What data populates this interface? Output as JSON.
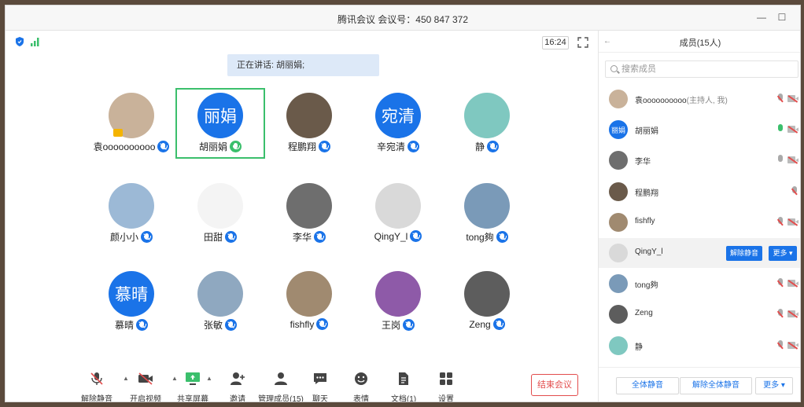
{
  "window": {
    "title": "腾讯会议 会议号：450 847 372"
  },
  "stage": {
    "clock": "16:24",
    "speaking": "正在讲话: 胡丽娟;"
  },
  "participants": [
    {
      "name": "袁oooooooooo",
      "avatar_text": "",
      "avatar_color": "#c9b29a",
      "host": true
    },
    {
      "name": "胡丽娟",
      "avatar_text": "丽娟",
      "avatar_color": "#1a73e8",
      "speaking": true
    },
    {
      "name": "程鹏翔",
      "avatar_text": "",
      "avatar_color": "#6a5a4a"
    },
    {
      "name": "辛宛清",
      "avatar_text": "宛清",
      "avatar_color": "#1a73e8"
    },
    {
      "name": "静",
      "avatar_text": "",
      "avatar_color": "#7fc8c0"
    },
    {
      "name": "颜小小",
      "avatar_text": "",
      "avatar_color": "#9cb9d6"
    },
    {
      "name": "田甜",
      "avatar_text": "",
      "avatar_color": "#f4f4f4"
    },
    {
      "name": "李华",
      "avatar_text": "",
      "avatar_color": "#6e6e6e"
    },
    {
      "name": "QingY_l",
      "avatar_text": "",
      "avatar_color": "#d9d9d9"
    },
    {
      "name": "tong夠",
      "avatar_text": "",
      "avatar_color": "#7a9ab8"
    },
    {
      "name": "慕晴",
      "avatar_text": "慕晴",
      "avatar_color": "#1a73e8"
    },
    {
      "name": "张敏",
      "avatar_text": "",
      "avatar_color": "#8fa8c0"
    },
    {
      "name": "fishfly",
      "avatar_text": "",
      "avatar_color": "#a08a70"
    },
    {
      "name": "王岗",
      "avatar_text": "",
      "avatar_color": "#8e5aa8"
    },
    {
      "name": "Zeng",
      "avatar_text": "",
      "avatar_color": "#5d5d5d"
    }
  ],
  "toolbar": {
    "unmute": "解除静音",
    "video": "开启视频",
    "share": "共享屏幕",
    "invite": "邀请",
    "manage": "管理成员(15)",
    "chat": "聊天",
    "reactions": "表情",
    "docs": "文档(1)",
    "settings": "设置",
    "end": "结束会议"
  },
  "panel": {
    "title": "成员(15人)",
    "search_placeholder": "搜索成员",
    "members": [
      {
        "name": "袁oooooooooo",
        "role": "(主持人, 我)",
        "avatar_color": "#c9b29a",
        "avatar_text": ""
      },
      {
        "name": "胡丽娟",
        "role": "",
        "avatar_color": "#1a73e8",
        "avatar_text": "丽娟"
      },
      {
        "name": "李华",
        "role": "",
        "avatar_color": "#6e6e6e",
        "avatar_text": ""
      },
      {
        "name": "程鹏翔",
        "role": "",
        "avatar_color": "#6a5a4a",
        "avatar_text": ""
      },
      {
        "name": "fishfly",
        "role": "",
        "avatar_color": "#a08a70",
        "avatar_text": ""
      },
      {
        "name": "QingY_l",
        "role": "",
        "avatar_color": "#d9d9d9",
        "avatar_text": ""
      },
      {
        "name": "tong夠",
        "role": "",
        "avatar_color": "#7a9ab8",
        "avatar_text": ""
      },
      {
        "name": "Zeng",
        "role": "",
        "avatar_color": "#5d5d5d",
        "avatar_text": ""
      },
      {
        "name": "静",
        "role": "",
        "avatar_color": "#7fc8c0",
        "avatar_text": ""
      }
    ],
    "hover_unmute": "解除静音",
    "hover_more": "更多",
    "mute_all": "全体静音",
    "unmute_all": "解除全体静音",
    "more": "更多"
  }
}
